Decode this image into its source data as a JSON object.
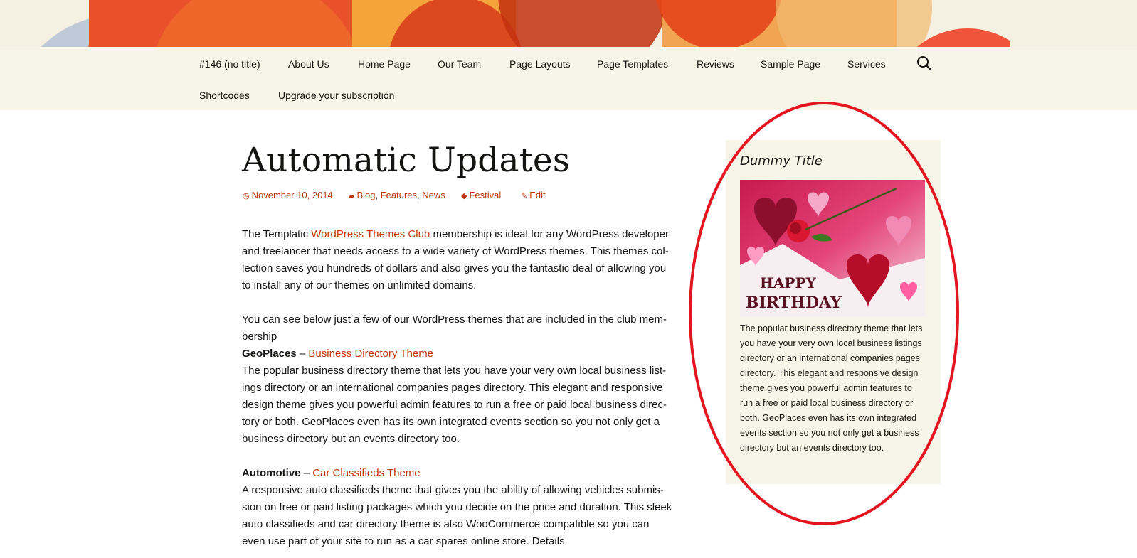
{
  "colors": {
    "link": "#bc360a",
    "navbar_bg": "#f7f5e7",
    "widget_bg": "#f7f5e7",
    "annotation": "#e3151f"
  },
  "nav": {
    "items": [
      "#146 (no title)",
      "About Us",
      "Home Page",
      "Our Team",
      "Page Layouts",
      "Page Templates",
      "Reviews",
      "Sample Page",
      "Services",
      "Shortcodes",
      "Upgrade your subscription"
    ],
    "search_icon": "search-icon"
  },
  "post": {
    "title": "Automatic Updates",
    "meta": {
      "date": "November 10, 2014",
      "categories": [
        "Blog",
        "Features",
        "News"
      ],
      "tag": "Festival",
      "edit": "Edit"
    },
    "content": {
      "p1_prefix": "The Templatic ",
      "p1_link": "WordPress Themes Club",
      "p1_suffix": " membership is ideal for any WordPress developer and freelancer that needs access to a wide variety of WordPress themes. This themes col­lection saves you hundreds of dollars and also gives you the fantastic deal of allowing you to install any of our themes on unlimited domains.",
      "p2": "You can see below just a few of our WordPress themes that are included in the club mem­bership",
      "geo_name": "GeoPlaces",
      "dash": " – ",
      "geo_link": "Business Directory Theme",
      "geo_desc": "The popular business directory theme that lets you have your very own local business list­ings directory or an international companies pages directory. This elegant and responsive design theme gives you powerful admin features to run a free or paid local business direc­tory or both. GeoPlaces even has its own integrated events section so you not only get a business directory but an events directory too.",
      "auto_name": "Automotive",
      "auto_link": "Car Classifieds Theme",
      "auto_desc": "A responsive auto classifieds theme that gives you the ability of allowing vehicles submis­sion on free or paid listing packages which you decide on the price and duration. This sleek auto classifieds and car directory theme is also WooCommerce compatible so you can even use part of your site to run as a car spares online store. Details"
    }
  },
  "widget": {
    "title": "Dummy Title",
    "image_text_line1": "HAPPY",
    "image_text_line2": "BIRTHDAY",
    "text": "The popular business directory theme that lets you have your very own local business listings directory or an international compa­nies pages directory. This elegant and re­sponsive design theme gives you powerful admin features to run a free or paid local business directory or both. GeoPlaces even has its own integrated events section so you not only get a business directory but an events directory too."
  }
}
